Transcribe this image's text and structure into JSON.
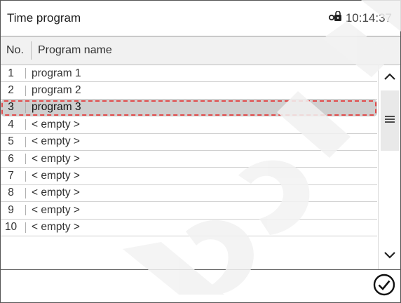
{
  "header": {
    "title": "Time program",
    "time": "10:14:37",
    "lock_icon": "padlock-key-icon"
  },
  "columns": {
    "no": "No.",
    "name": "Program name"
  },
  "rows": [
    {
      "no": "1",
      "name": "program 1",
      "selected": false
    },
    {
      "no": "2",
      "name": "program 2",
      "selected": false
    },
    {
      "no": "3",
      "name": "program 3",
      "selected": true
    },
    {
      "no": "4",
      "name": "< empty >",
      "selected": false
    },
    {
      "no": "5",
      "name": "< empty >",
      "selected": false
    },
    {
      "no": "6",
      "name": "< empty >",
      "selected": false
    },
    {
      "no": "7",
      "name": "< empty >",
      "selected": false
    },
    {
      "no": "8",
      "name": "< empty >",
      "selected": false
    },
    {
      "no": "9",
      "name": "< empty >",
      "selected": false
    },
    {
      "no": "10",
      "name": "< empty >",
      "selected": false
    }
  ],
  "scrollbar": {
    "up_icon": "chevron-up-icon",
    "down_icon": "chevron-down-icon",
    "thumb_icon": "grip-lines-icon"
  },
  "footer": {
    "confirm_icon": "checkmark-circle-icon"
  },
  "colors": {
    "selected_row_bg": "#cfcfcf",
    "selected_outline": "#e14b4b",
    "border": "#555555"
  }
}
